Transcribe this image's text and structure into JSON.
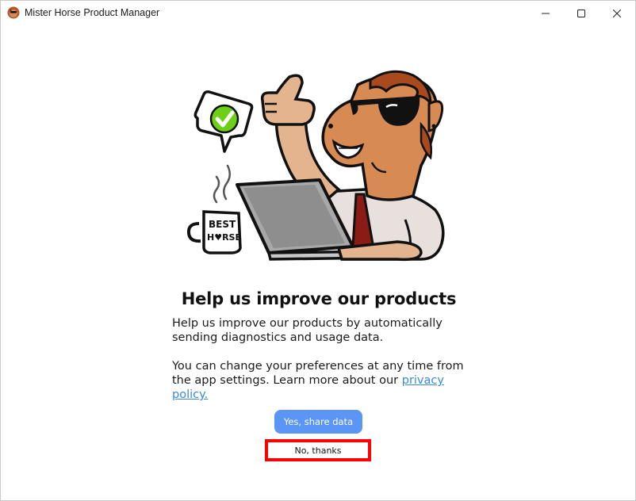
{
  "window": {
    "title": "Mister Horse Product Manager",
    "controls": {
      "minimize_icon": "minimize-icon",
      "maximize_icon": "maximize-icon",
      "close_icon": "close-icon"
    }
  },
  "illustration": {
    "mug_text_line1": "BEST",
    "mug_text_line2": "H♥RSE"
  },
  "content": {
    "headline": "Help us improve our products",
    "paragraph1": "Help us improve our products by automatically sending diagnostics and usage data.",
    "paragraph2_prefix": "You can change your preferences at any time from the app settings. Learn more about our",
    "privacy_link": "privacy policy."
  },
  "actions": {
    "accept_label": "Yes, share data",
    "decline_label": "No, thanks"
  },
  "colors": {
    "accept_button": "#5b95f5",
    "link": "#3b87d9",
    "highlight_border": "#ff0000"
  }
}
